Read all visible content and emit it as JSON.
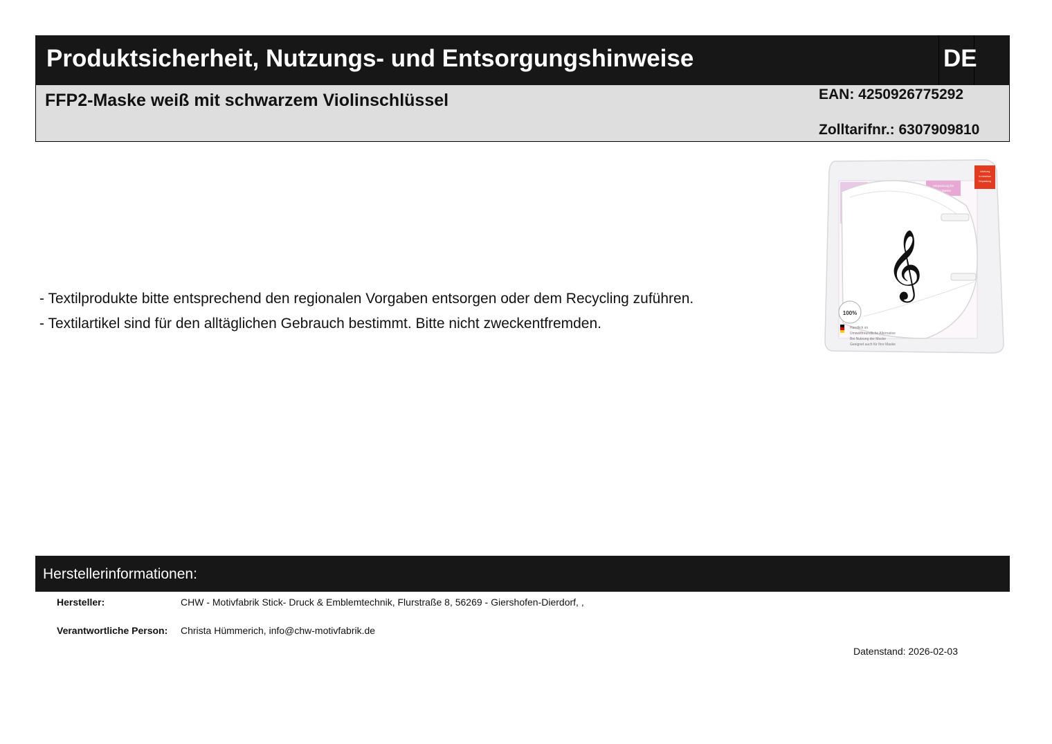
{
  "header": {
    "title": "Produktsicherheit, Nutzungs- und Entsorgungshinweise",
    "language": "DE"
  },
  "product": {
    "name": "FFP2-Maske weiß mit schwarzem Violinschlüssel",
    "ean": "EAN: 4250926775292",
    "zolltarif": "Zolltarifnr.: 6307909810",
    "image": {
      "label_top_right": "Lieferung\nin einzelner\nVerpackung",
      "label_pink": "Verpackung für\nIhre Maske",
      "seal": "100%",
      "bottom_text": [
        "Handlich im",
        "Umweltfreundliche Alternative",
        "Bei Nutzung der Maske",
        "Geeignet auch für Ihre Maske"
      ]
    }
  },
  "notes": [
    "- Textilprodukte bitte entsprechend den regionalen Vorgaben entsorgen oder dem Recycling zuführen.",
    "- Textilartikel sind für den alltäglichen Gebrauch bestimmt. Bitte nicht zweckentfremden."
  ],
  "manufacturer": {
    "section_title": "Herstellerinformationen:",
    "maker_label": "Hersteller:",
    "maker_value": "CHW - Motivfabrik Stick- Druck & Emblemtechnik, Flurstraße 8, 56269  - Giershofen-Dierdorf, ,",
    "person_label": "Verantwortliche Person:",
    "person_value": "Christa Hümmerich, info@chw-motivfabrik.de"
  },
  "datenstand": "Datenstand: 2026-02-03"
}
